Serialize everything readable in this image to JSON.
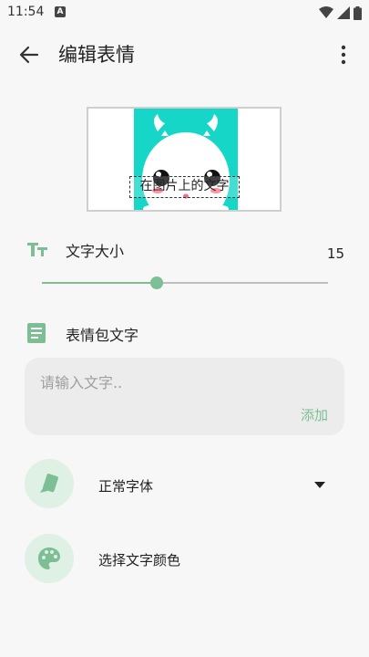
{
  "status": {
    "time": "11:54",
    "badge": "A"
  },
  "app_bar": {
    "title": "编辑表情"
  },
  "preview": {
    "overlay_text": "在图片上的文字"
  },
  "font_size": {
    "label": "文字大小",
    "value": "15",
    "slider_fraction": 0.4
  },
  "meme_text": {
    "label": "表情包文字",
    "placeholder": "请输入文字..",
    "add_label": "添加"
  },
  "font_option": {
    "label": "正常字体"
  },
  "color_option": {
    "label": "选择文字颜色"
  },
  "colors": {
    "accent": "#7dbe94",
    "accent_light": "#dff0e5",
    "preview_bg": "#16d6c8"
  }
}
